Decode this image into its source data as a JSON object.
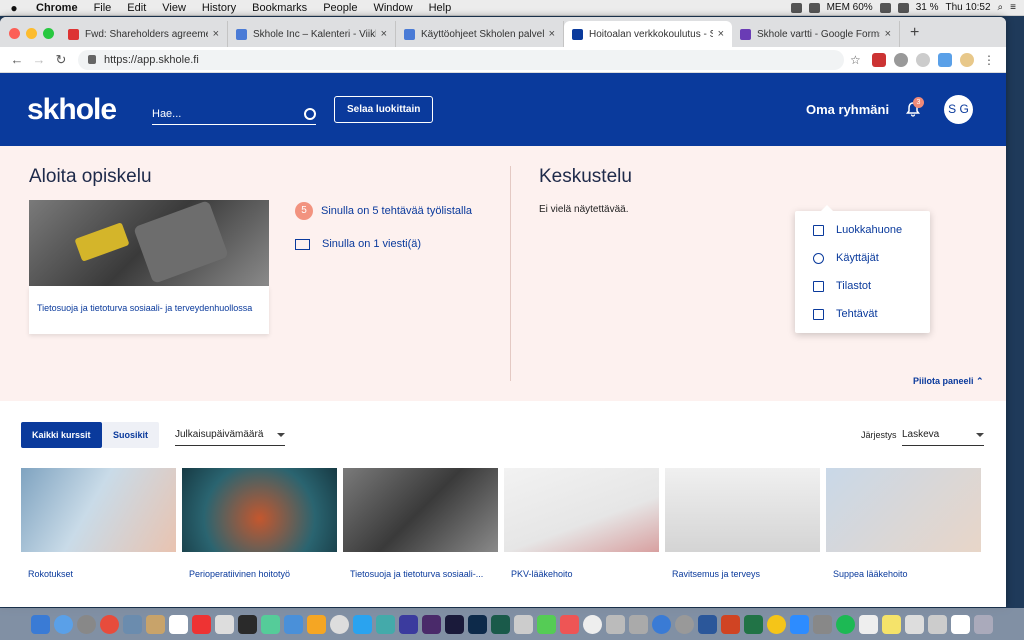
{
  "mac": {
    "app": "Chrome",
    "menus": [
      "File",
      "Edit",
      "View",
      "History",
      "Bookmarks",
      "People",
      "Window",
      "Help"
    ],
    "battery": "31 %",
    "time": "Thu 10:52",
    "mem": "MEM 60%"
  },
  "tabs": [
    {
      "title": "Fwd: Shareholders agreement",
      "color": "#d33"
    },
    {
      "title": "Skhole Inc – Kalenteri - Viikko",
      "color": "#4a7bd6"
    },
    {
      "title": "Käyttöohjeet Skholen palveluun",
      "color": "#4a7bd6"
    },
    {
      "title": "Hoitoalan verkkokoulutus - Skhole",
      "color": "#0a3a9c"
    },
    {
      "title": "Skhole vartti - Google Forms",
      "color": "#6a3cb5"
    }
  ],
  "url": "https://app.skhole.fi",
  "header": {
    "logo": "skhole",
    "search_placeholder": "Hae...",
    "browse": "Selaa luokittain",
    "group": "Oma ryhmäni",
    "notif_count": "3",
    "avatar": "S G"
  },
  "dropdown": [
    "Luokkahuone",
    "Käyttäjät",
    "Tilastot",
    "Tehtävät"
  ],
  "panel": {
    "study_title": "Aloita opiskelu",
    "card_title": "Tietosuoja ja tietoturva sosiaali- ja terveydenhuollossa",
    "tasks_count": "5",
    "tasks_text": "Sinulla on 5 tehtävää työlistalla",
    "msg_text": "Sinulla on 1 viesti(ä)",
    "discussion_title": "Keskustelu",
    "no_show": "Ei vielä näytettävää.",
    "hide": "Piilota paneeli"
  },
  "filters": {
    "all": "Kaikki kurssit",
    "fav": "Suosikit",
    "date": "Julkaisupäivämäärä",
    "sort_label": "Järjestys",
    "sort": "Laskeva"
  },
  "courses": [
    {
      "title": "Rokotukset"
    },
    {
      "title": "Perioperatiivinen hoitotyö"
    },
    {
      "title": "Tietosuoja ja tietoturva sosiaali-..."
    },
    {
      "title": "PKV-lääkehoito"
    },
    {
      "title": "Ravitsemus ja terveys"
    },
    {
      "title": "Suppea lääkehoito"
    }
  ]
}
